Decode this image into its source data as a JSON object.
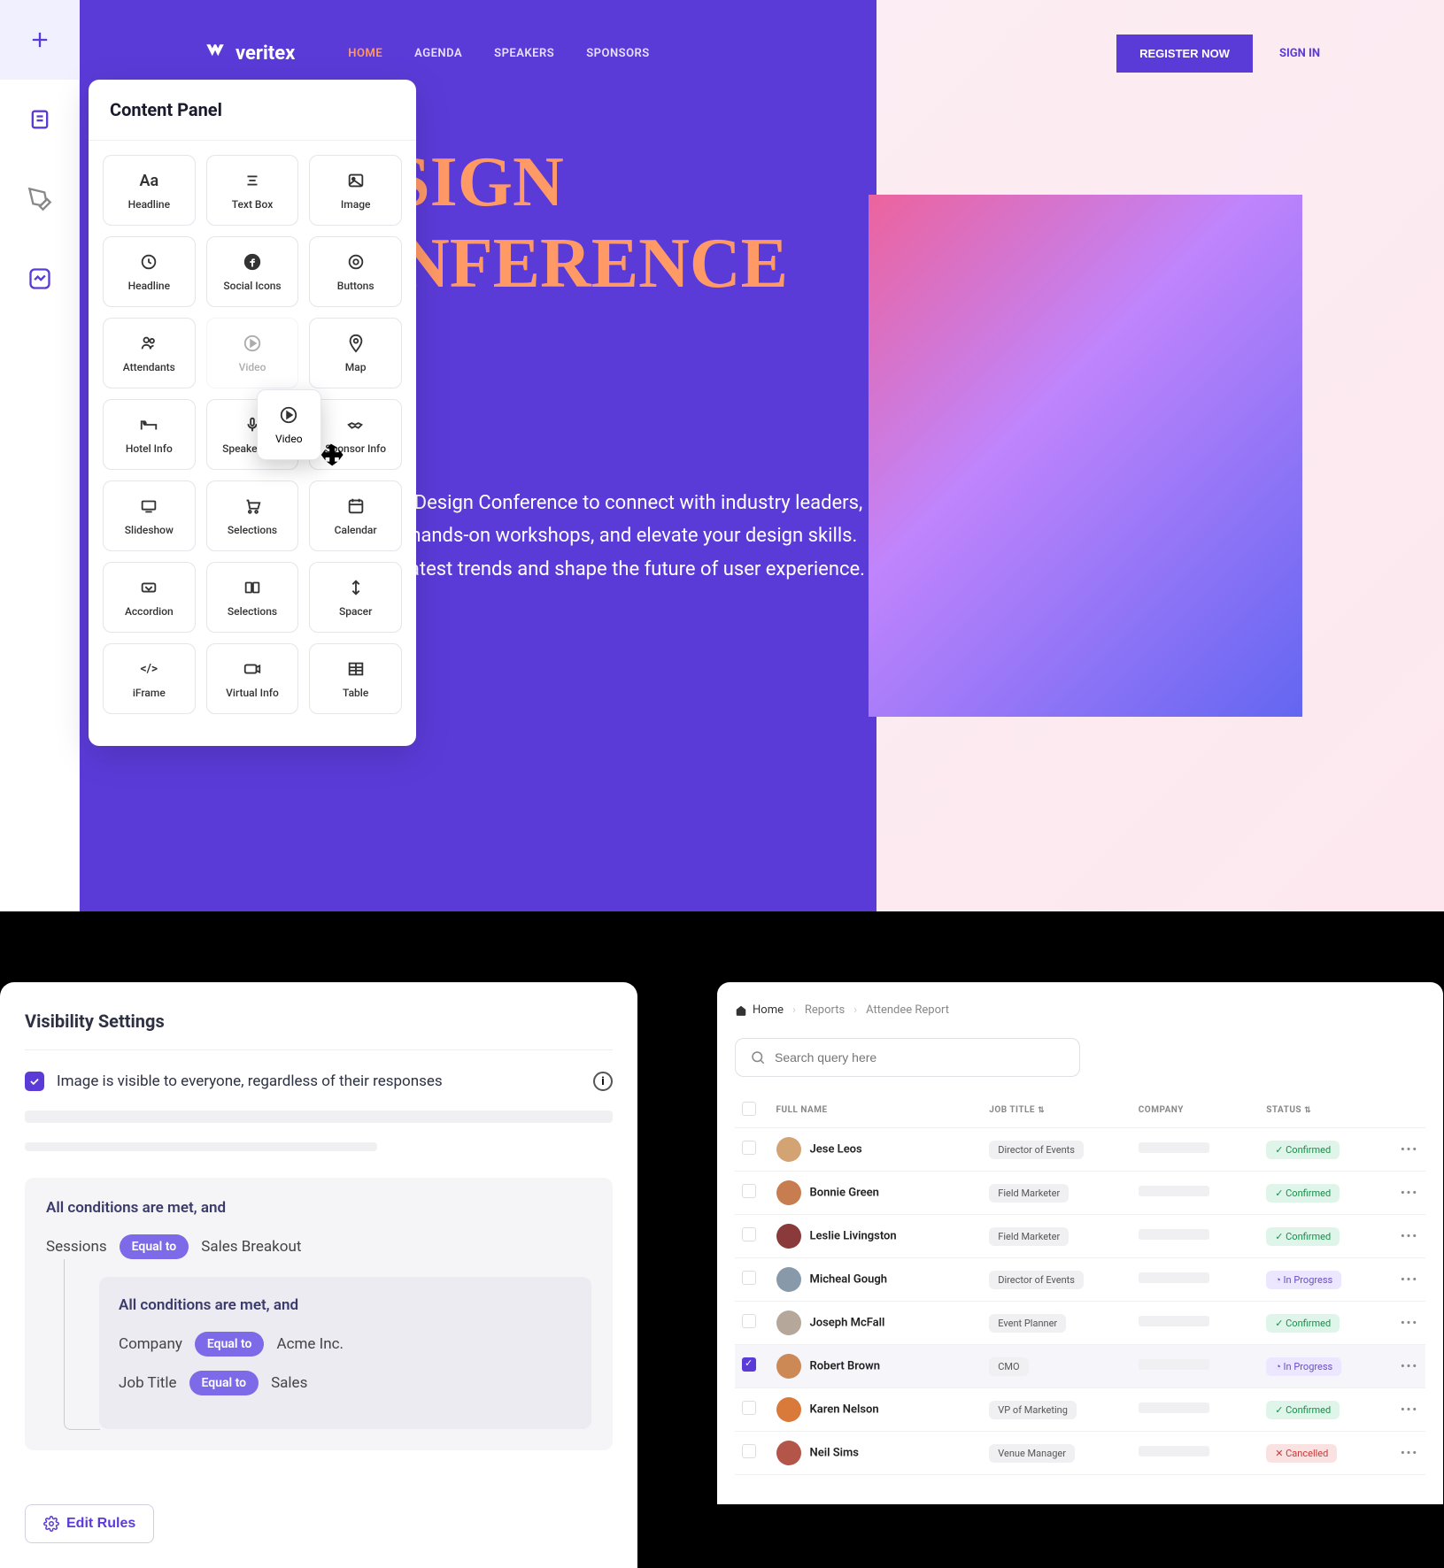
{
  "builder": {
    "panel_title": "Content Panel",
    "items": [
      {
        "label": "Headline",
        "icon": "Aa"
      },
      {
        "label": "Text Box",
        "icon": "text"
      },
      {
        "label": "Image",
        "icon": "image"
      },
      {
        "label": "Headline",
        "icon": "headline2"
      },
      {
        "label": "Social Icons",
        "icon": "social"
      },
      {
        "label": "Buttons",
        "icon": "buttons"
      },
      {
        "label": "Attendants",
        "icon": "attendants"
      },
      {
        "label": "Video",
        "icon": "video",
        "ghost": true
      },
      {
        "label": "Map",
        "icon": "map"
      },
      {
        "label": "Hotel Info",
        "icon": "hotel"
      },
      {
        "label": "Speaker Info",
        "icon": "speaker"
      },
      {
        "label": "Sponsor Info",
        "icon": "sponsor"
      },
      {
        "label": "Slideshow",
        "icon": "slideshow"
      },
      {
        "label": "Selections",
        "icon": "selections"
      },
      {
        "label": "Calendar",
        "icon": "calendar"
      },
      {
        "label": "Accordion",
        "icon": "accordion"
      },
      {
        "label": "Selections",
        "icon": "selections2"
      },
      {
        "label": "Spacer",
        "icon": "spacer"
      },
      {
        "label": "iFrame",
        "icon": "iframe"
      },
      {
        "label": "Virtual Info",
        "icon": "virtual"
      },
      {
        "label": "Table",
        "icon": "table"
      }
    ],
    "dragging_label": "Video"
  },
  "preview": {
    "brand": "veritex",
    "nav": [
      "HOME",
      "AGENDA",
      "SPEAKERS",
      "SPONSORS"
    ],
    "register": "REGISTER NOW",
    "signin": "SIGN IN",
    "hero_line1": "DESIGN",
    "hero_line2": "CONFERENCE",
    "desc_l1": "Join us at the Design Conference to connect with industry leaders,",
    "desc_l2": "participate in hands-on workshops, and elevate your design skills.",
    "desc_l3": "Discover the latest trends and shape the future of user experience."
  },
  "visibility": {
    "title": "Visibility Settings",
    "checkbox_label": "Image is visible to everyone, regardless of their responses",
    "rule_heading": "All conditions are met, and",
    "rule1_field": "Sessions",
    "rule1_op": "Equal to",
    "rule1_value": "Sales Breakout",
    "nested_heading": "All conditions are met, and",
    "rule2_field": "Company",
    "rule2_op": "Equal to",
    "rule2_value": "Acme Inc.",
    "rule3_field": "Job Title",
    "rule3_op": "Equal to",
    "rule3_value": "Sales",
    "edit_btn": "Edit Rules"
  },
  "report": {
    "crumbs": [
      "Home",
      "Reports",
      "Attendee Report"
    ],
    "search_placeholder": "Search query here",
    "cols": {
      "name": "FULL NAME",
      "job": "JOB TITLE",
      "company": "COMPANY",
      "status": "STATUS"
    },
    "rows": [
      {
        "name": "Jese Leos",
        "job": "Director of Events",
        "status": "Confirmed",
        "avatar": "#d4a373",
        "selected": false
      },
      {
        "name": "Bonnie Green",
        "job": "Field Marketer",
        "status": "Confirmed",
        "avatar": "#c77d50",
        "selected": false
      },
      {
        "name": "Leslie Livingston",
        "job": "Field Marketer",
        "status": "Confirmed",
        "avatar": "#8a3a3a",
        "selected": false
      },
      {
        "name": "Micheal Gough",
        "job": "Director of Events",
        "status": "In Progress",
        "avatar": "#8899aa",
        "selected": false
      },
      {
        "name": "Joseph McFall",
        "job": "Event Planner",
        "status": "Confirmed",
        "avatar": "#b5a89a",
        "selected": false
      },
      {
        "name": "Robert Brown",
        "job": "CMO",
        "status": "In Progress",
        "avatar": "#cc8855",
        "selected": true
      },
      {
        "name": "Karen Nelson",
        "job": "VP of Marketing",
        "status": "Confirmed",
        "avatar": "#d97a3a",
        "selected": false
      },
      {
        "name": "Neil Sims",
        "job": "Venue Manager",
        "status": "Cancelled",
        "avatar": "#b4554a",
        "selected": false
      }
    ],
    "status_labels": {
      "Confirmed": "Confirmed",
      "In Progress": "In Progress",
      "Cancelled": "Cancelled"
    }
  }
}
